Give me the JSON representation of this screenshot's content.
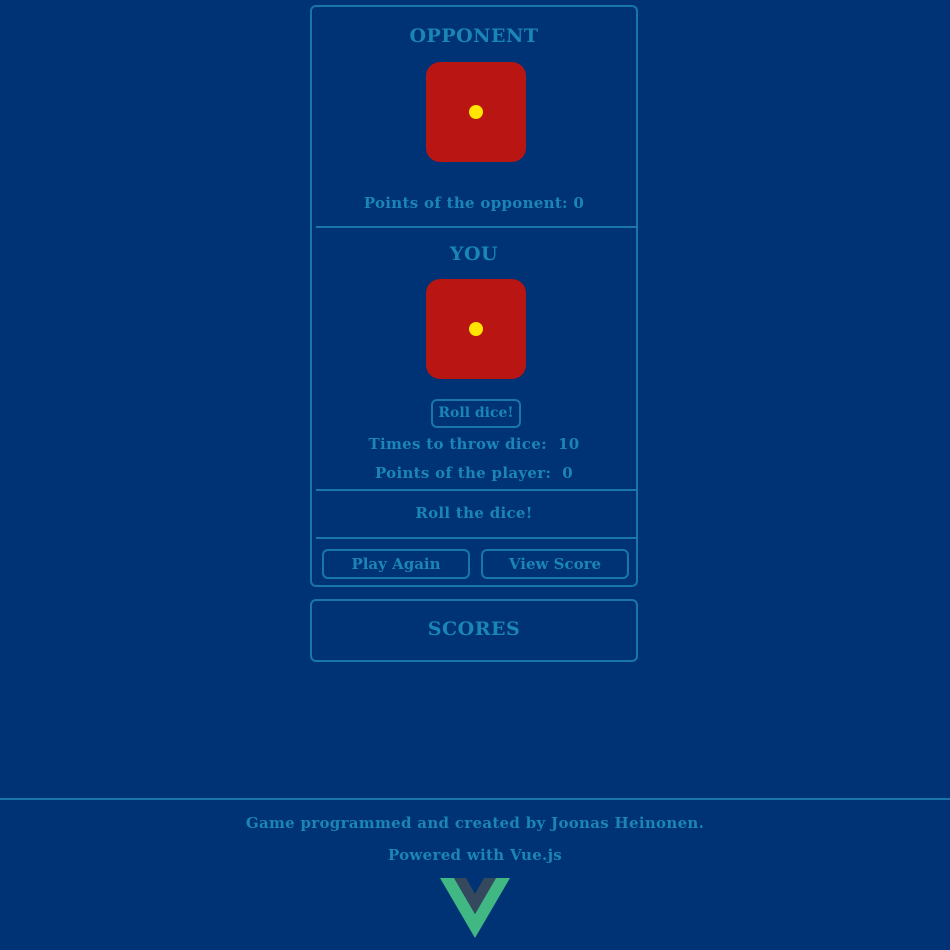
{
  "opponent": {
    "title": "OPPONENT",
    "die_value": 1,
    "points_text": "Points of the opponent: 0"
  },
  "player": {
    "title": "YOU",
    "die_value": 1,
    "roll_button_label": "Roll dice!",
    "throws_label": "Times to throw dice:",
    "throws_value": "10",
    "points_label": "Points of the player:",
    "points_value": "0"
  },
  "status_message": "Roll the dice!",
  "actions": {
    "play_again_label": "Play Again",
    "view_score_label": "View Score"
  },
  "scores": {
    "title": "SCORES"
  },
  "footer": {
    "credit": "Game programmed and created by Joonas Heinonen.",
    "powered_by": "Powered with Vue.js",
    "logo_icon": "vue-logo-icon"
  },
  "colors": {
    "background": "#003375",
    "accent": "#1b85b8",
    "die_face": "#b81513",
    "die_pip": "#ffe500",
    "vue_green": "#41b883",
    "vue_dark": "#35495e"
  }
}
